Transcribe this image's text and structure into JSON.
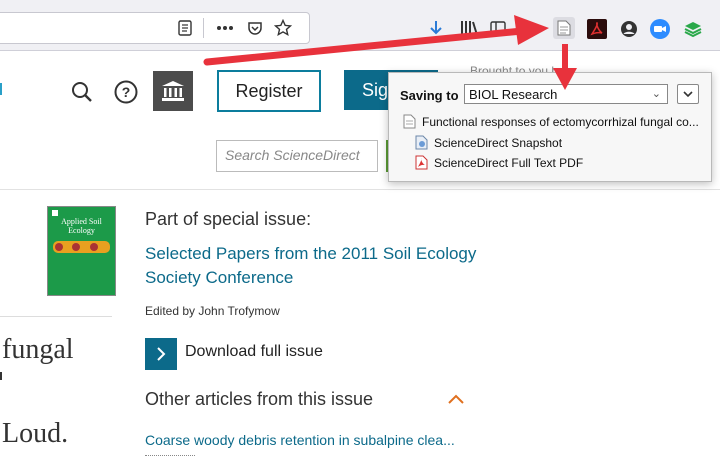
{
  "site_header": {
    "register_label": "Register",
    "signin_label": "Sign in",
    "brought_text": "Brought to you by",
    "search_placeholder": "Search ScienceDirect"
  },
  "zotero_popup": {
    "saving_label": "Saving to",
    "collection": "BIOL Research",
    "item_title": "Functional responses of ectomycorrhizal fungal co...",
    "attachments": [
      {
        "label": "ScienceDirect Snapshot",
        "icon": "snapshot-icon"
      },
      {
        "label": "ScienceDirect Full Text PDF",
        "icon": "pdf-icon"
      }
    ]
  },
  "article": {
    "cover_title": "Applied Soil Ecology",
    "special_issue_heading": "Part of special issue:",
    "special_issue_line1": "Selected Papers from the 2011 Soil Ecology",
    "special_issue_line2": "Society Conference",
    "edited_by": "Edited by John Trofymow",
    "download_label": "Download full issue",
    "other_articles_heading": "Other articles from this issue",
    "first_article": "Coarse woody debris retention in subalpine clea...",
    "left_title_fragment_1": "fungal",
    "left_title_fragment_2": "Loud."
  },
  "colors": {
    "accent": "#0c6a8a",
    "arrow": "#e8323c",
    "cover": "#1c9a49",
    "caret": "#e0701f"
  }
}
